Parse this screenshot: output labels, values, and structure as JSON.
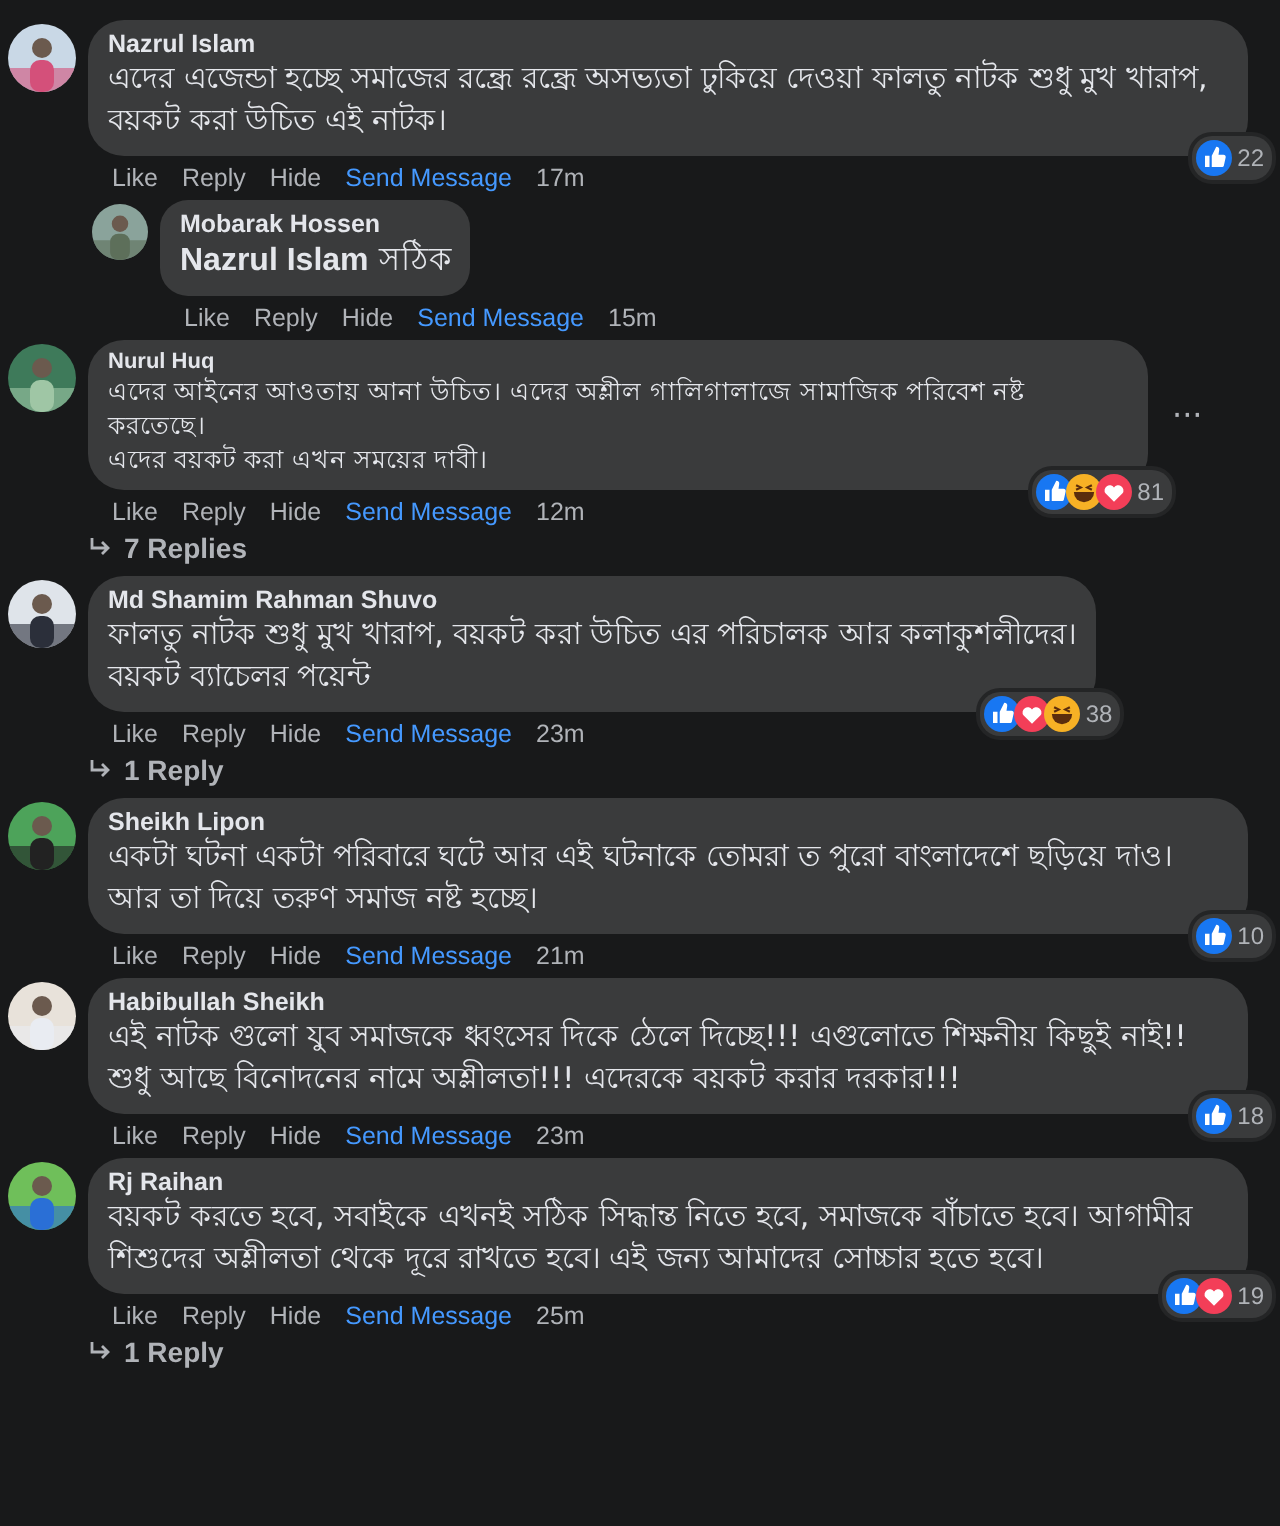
{
  "comments": [
    {
      "kind": "comment",
      "author": "Nazrul Islam",
      "text": "এদের এজেন্ডা হচ্ছে সমাজের রন্ধ্রে রন্ধ্রে অসভ্যতা ঢুকিয়ে দেওয়া ফালতু নাটক শুধু মুখ খারাপ, বয়কট করা উচিত এই নাটক।",
      "actions": [
        "Like",
        "Reply",
        "Hide",
        "Send Message"
      ],
      "time": "17m",
      "reactions": [
        {
          "kind": "like"
        }
      ],
      "count": "22"
    },
    {
      "kind": "reply",
      "author": "Mobarak Hossen",
      "text": "**Nazrul Islam** সঠিক",
      "actions": [
        "Like",
        "Reply",
        "Hide",
        "Send Message"
      ],
      "time": "15m"
    },
    {
      "kind": "compact",
      "author": "Nurul Huq",
      "text": "এদের আইনের আওতায় আনা উচিত। এদের অশ্লীল গালিগালাজে সামাজিক পরিবেশ নষ্ট করতেছে।\nএদের বয়কট করা এখন সময়ের দাবী।",
      "menu": "···",
      "actions": [
        "Like",
        "Reply",
        "Hide",
        "Send Message"
      ],
      "time": "12m",
      "reactions": [
        {
          "kind": "like"
        },
        {
          "kind": "haha"
        },
        {
          "kind": "love"
        }
      ],
      "count": "81",
      "replies": "7 Replies"
    },
    {
      "kind": "comment",
      "author": "Md Shamim Rahman Shuvo",
      "text": "ফালতু নাটক শুধু মুখ খারাপ, বয়কট করা উচিত এর পরিচালক আর কলাকুশলীদের।\nবয়কট ব্যাচেলর পয়েন্ট",
      "actions": [
        "Like",
        "Reply",
        "Hide",
        "Send Message"
      ],
      "time": "23m",
      "reactions": [
        {
          "kind": "like"
        },
        {
          "kind": "love"
        },
        {
          "kind": "haha"
        }
      ],
      "count": "38",
      "replies": "1 Reply"
    },
    {
      "kind": "comment",
      "author": "Sheikh Lipon",
      "text": "একটা ঘটনা একটা পরিবারে ঘটে আর এই ঘটনাকে তোমরা ত পুরো বাংলাদেশে ছড়িয়ে দাও। আর তা দিয়ে তরুণ সমাজ নষ্ট হচ্ছে।",
      "actions": [
        "Like",
        "Reply",
        "Hide",
        "Send Message"
      ],
      "time": "21m",
      "reactions": [
        {
          "kind": "like"
        }
      ],
      "count": "10"
    },
    {
      "kind": "comment",
      "author": "Habibullah Sheikh",
      "text": "এই নাটক গুলো যুব সমাজকে ধ্বংসের দিকে ঠেলে দিচ্ছে!!! এগুলোতে শিক্ষনীয় কিছুই নাই!! শুধু আছে বিনোদনের নামে অশ্লীলতা!!! এদেরকে বয়কট করার দরকার!!!",
      "actions": [
        "Like",
        "Reply",
        "Hide",
        "Send Message"
      ],
      "time": "23m",
      "reactions": [
        {
          "kind": "like"
        }
      ],
      "count": "18"
    },
    {
      "kind": "comment",
      "author": "Rj Raihan",
      "text": "বয়কট করতে হবে, সবাইকে এখনই সঠিক সিদ্ধান্ত নিতে হবে, সমাজকে বাঁচাতে হবে। আগামীর শিশুদের অশ্লীলতা থেকে দূরে রাখতে হবে। এই জন্য আমাদের সোচ্চার হতে হবে।",
      "actions": [
        "Like",
        "Reply",
        "Hide",
        "Send Message"
      ],
      "time": "25m",
      "reactions": [
        {
          "kind": "like"
        },
        {
          "kind": "love"
        }
      ],
      "count": "19",
      "replies": "1 Reply"
    }
  ]
}
